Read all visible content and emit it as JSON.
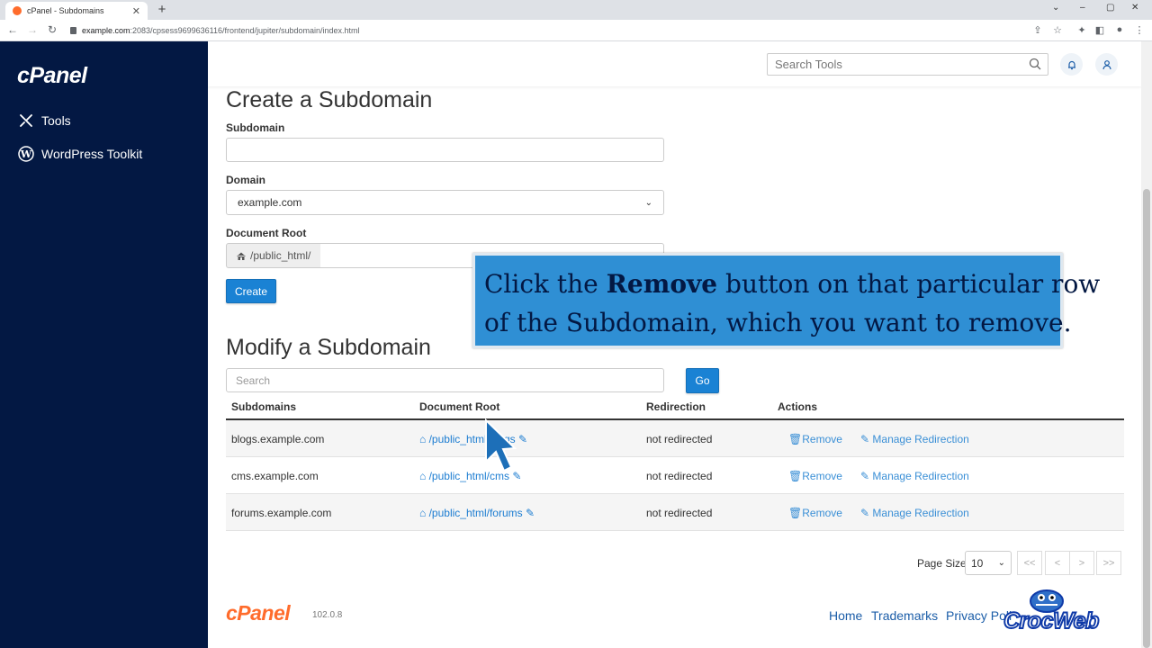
{
  "browser": {
    "tab_title": "cPanel - Subdomains",
    "url_host": "example.com",
    "url_path": ":2083/cpsess9699636116/frontend/jupiter/subdomain/index.html"
  },
  "sidebar": {
    "logo": "cPanel",
    "items": [
      {
        "label": "Tools",
        "icon": "tools-icon"
      },
      {
        "label": "WordPress Toolkit",
        "icon": "wordpress-icon"
      }
    ]
  },
  "header": {
    "search_placeholder": "Search Tools"
  },
  "create": {
    "title": "Create a Subdomain",
    "subdomain_label": "Subdomain",
    "domain_label": "Domain",
    "domain_value": "example.com",
    "docroot_label": "Document Root",
    "docroot_prefix": "/public_html/",
    "create_button": "Create"
  },
  "modify": {
    "title": "Modify a Subdomain",
    "search_placeholder": "Search",
    "go_button": "Go",
    "columns": [
      "Subdomains",
      "Document Root",
      "Redirection",
      "Actions"
    ],
    "rows": [
      {
        "subdomain": "blogs.example.com",
        "docroot": "/public_html/blogs",
        "redirection": "not redirected",
        "remove": "Remove",
        "manage": "Manage Redirection"
      },
      {
        "subdomain": "cms.example.com",
        "docroot": "/public_html/cms",
        "redirection": "not redirected",
        "remove": "Remove",
        "manage": "Manage Redirection"
      },
      {
        "subdomain": "forums.example.com",
        "docroot": "/public_html/forums",
        "redirection": "not redirected",
        "remove": "Remove",
        "manage": "Manage Redirection"
      }
    ]
  },
  "pager": {
    "label": "Page Size",
    "size": "10",
    "first": "<<",
    "prev": "<",
    "next": ">",
    "last": ">>"
  },
  "footer": {
    "logo": "cPanel",
    "version": "102.0.8",
    "links": [
      "Home",
      "Trademarks",
      "Privacy Poli"
    ]
  },
  "overlay": {
    "line1_pre": "Click the ",
    "line1_bold": "Remove",
    "line1_post": " button on that particular row",
    "line2": "of the Subdomain, which you want to remove."
  },
  "watermark": {
    "text": "CrocWeb"
  },
  "colors": {
    "sidebar_bg": "#031843",
    "accent": "#1a82d4",
    "brand_orange": "#ff6c2c",
    "overlay_bg": "#2f8fd4"
  }
}
